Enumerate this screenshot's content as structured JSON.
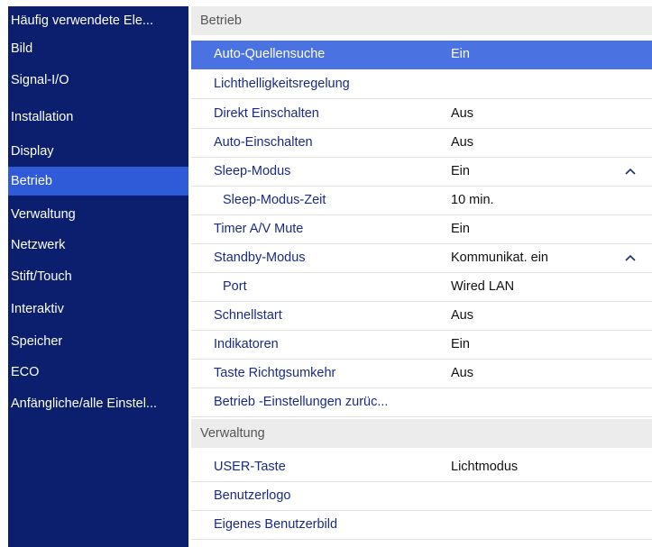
{
  "sidebar": {
    "items": [
      {
        "label": "Häufig verwendete Ele...",
        "active": false
      },
      {
        "label": "Bild",
        "active": false
      },
      {
        "label": "Signal-I/O",
        "active": false
      },
      {
        "label": "Installation",
        "active": false
      },
      {
        "label": "Display",
        "active": false
      },
      {
        "label": "Betrieb",
        "active": true
      },
      {
        "label": "Verwaltung",
        "active": false
      },
      {
        "label": "Netzwerk",
        "active": false
      },
      {
        "label": "Stift/Touch",
        "active": false
      },
      {
        "label": "Interaktiv",
        "active": false
      },
      {
        "label": "Speicher",
        "active": false
      },
      {
        "label": "ECO",
        "active": false
      },
      {
        "label": "Anfängliche/alle Einstel...",
        "active": false
      }
    ]
  },
  "main": {
    "section1": {
      "title": "Betrieb",
      "rows": [
        {
          "label": "Auto-Quellensuche",
          "value": "Ein",
          "selected": true
        },
        {
          "label": "Lichthelligkeitsregelung",
          "value": ""
        },
        {
          "label": "Direkt Einschalten",
          "value": "Aus"
        },
        {
          "label": "Auto-Einschalten",
          "value": "Aus"
        },
        {
          "label": "Sleep-Modus",
          "value": "Ein",
          "expanded": true
        },
        {
          "label": "Sleep-Modus-Zeit",
          "value": "10 min.",
          "sub": true
        },
        {
          "label": "Timer A/V Mute",
          "value": "Ein"
        },
        {
          "label": "Standby-Modus",
          "value": "Kommunikat. ein",
          "expanded": true
        },
        {
          "label": "Port",
          "value": "Wired LAN",
          "sub": true
        },
        {
          "label": "Schnellstart",
          "value": "Aus"
        },
        {
          "label": "Indikatoren",
          "value": "Ein"
        },
        {
          "label": "Taste Richtgsumkehr",
          "value": "Aus"
        },
        {
          "label": "Betrieb -Einstellungen zurüc...",
          "value": ""
        }
      ]
    },
    "section2": {
      "title": "Verwaltung",
      "rows": [
        {
          "label": "USER-Taste",
          "value": "Lichtmodus"
        },
        {
          "label": "Benutzerlogo",
          "value": ""
        },
        {
          "label": "Eigenes Benutzerbild",
          "value": ""
        }
      ]
    }
  },
  "colors": {
    "sidebar_bg": "#0b1f6e",
    "sidebar_active": "#2f5bd9",
    "row_selected": "#4a72e0",
    "label_text": "#1a2b80",
    "header_bg": "#ececec"
  },
  "icons": {
    "expand": "chevron-up-icon"
  }
}
